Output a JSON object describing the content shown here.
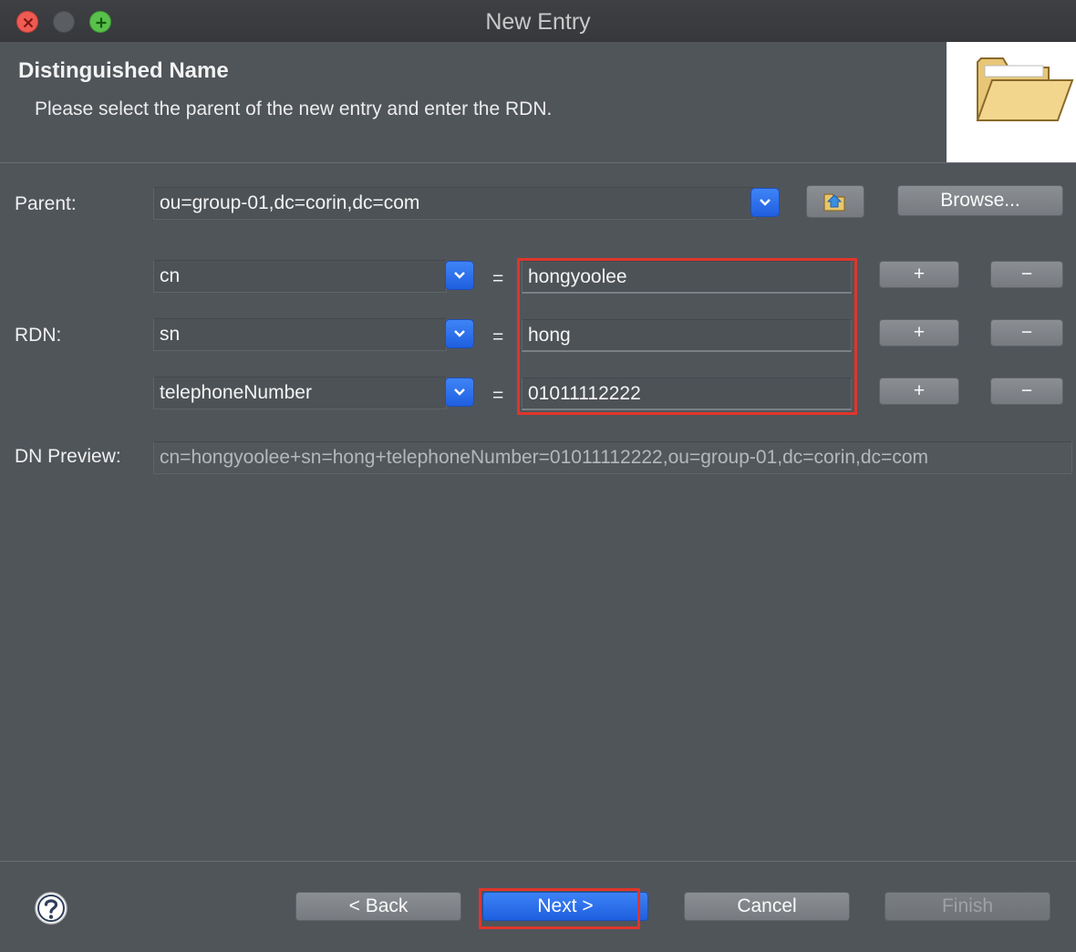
{
  "window": {
    "title": "New Entry"
  },
  "header": {
    "title": "Distinguished Name",
    "description": "Please select the parent of the new entry and enter the RDN.",
    "image_icon": "open-folder-icon"
  },
  "parent": {
    "label": "Parent:",
    "value": "ou=group-01,dc=corin,dc=com",
    "up_button_icon": "parent-folder-up-icon",
    "browse_label": "Browse..."
  },
  "rdn": {
    "label": "RDN:",
    "equals": "=",
    "add_label": "+",
    "remove_label": "−",
    "rows": [
      {
        "attribute": "cn",
        "value": "hongyoolee"
      },
      {
        "attribute": "sn",
        "value": "hong"
      },
      {
        "attribute": "telephoneNumber",
        "value": "01011112222"
      }
    ]
  },
  "dn_preview": {
    "label": "DN Preview:",
    "value": "cn=hongyoolee+sn=hong+telephoneNumber=01011112222,ou=group-01,dc=corin,dc=com"
  },
  "footer": {
    "help_icon": "help-icon",
    "back_label": "< Back",
    "next_label": "Next >",
    "cancel_label": "Cancel",
    "finish_label": "Finish"
  },
  "colors": {
    "accent": "#2a6ef0",
    "highlight": "#e0352b",
    "background": "#50555a"
  }
}
